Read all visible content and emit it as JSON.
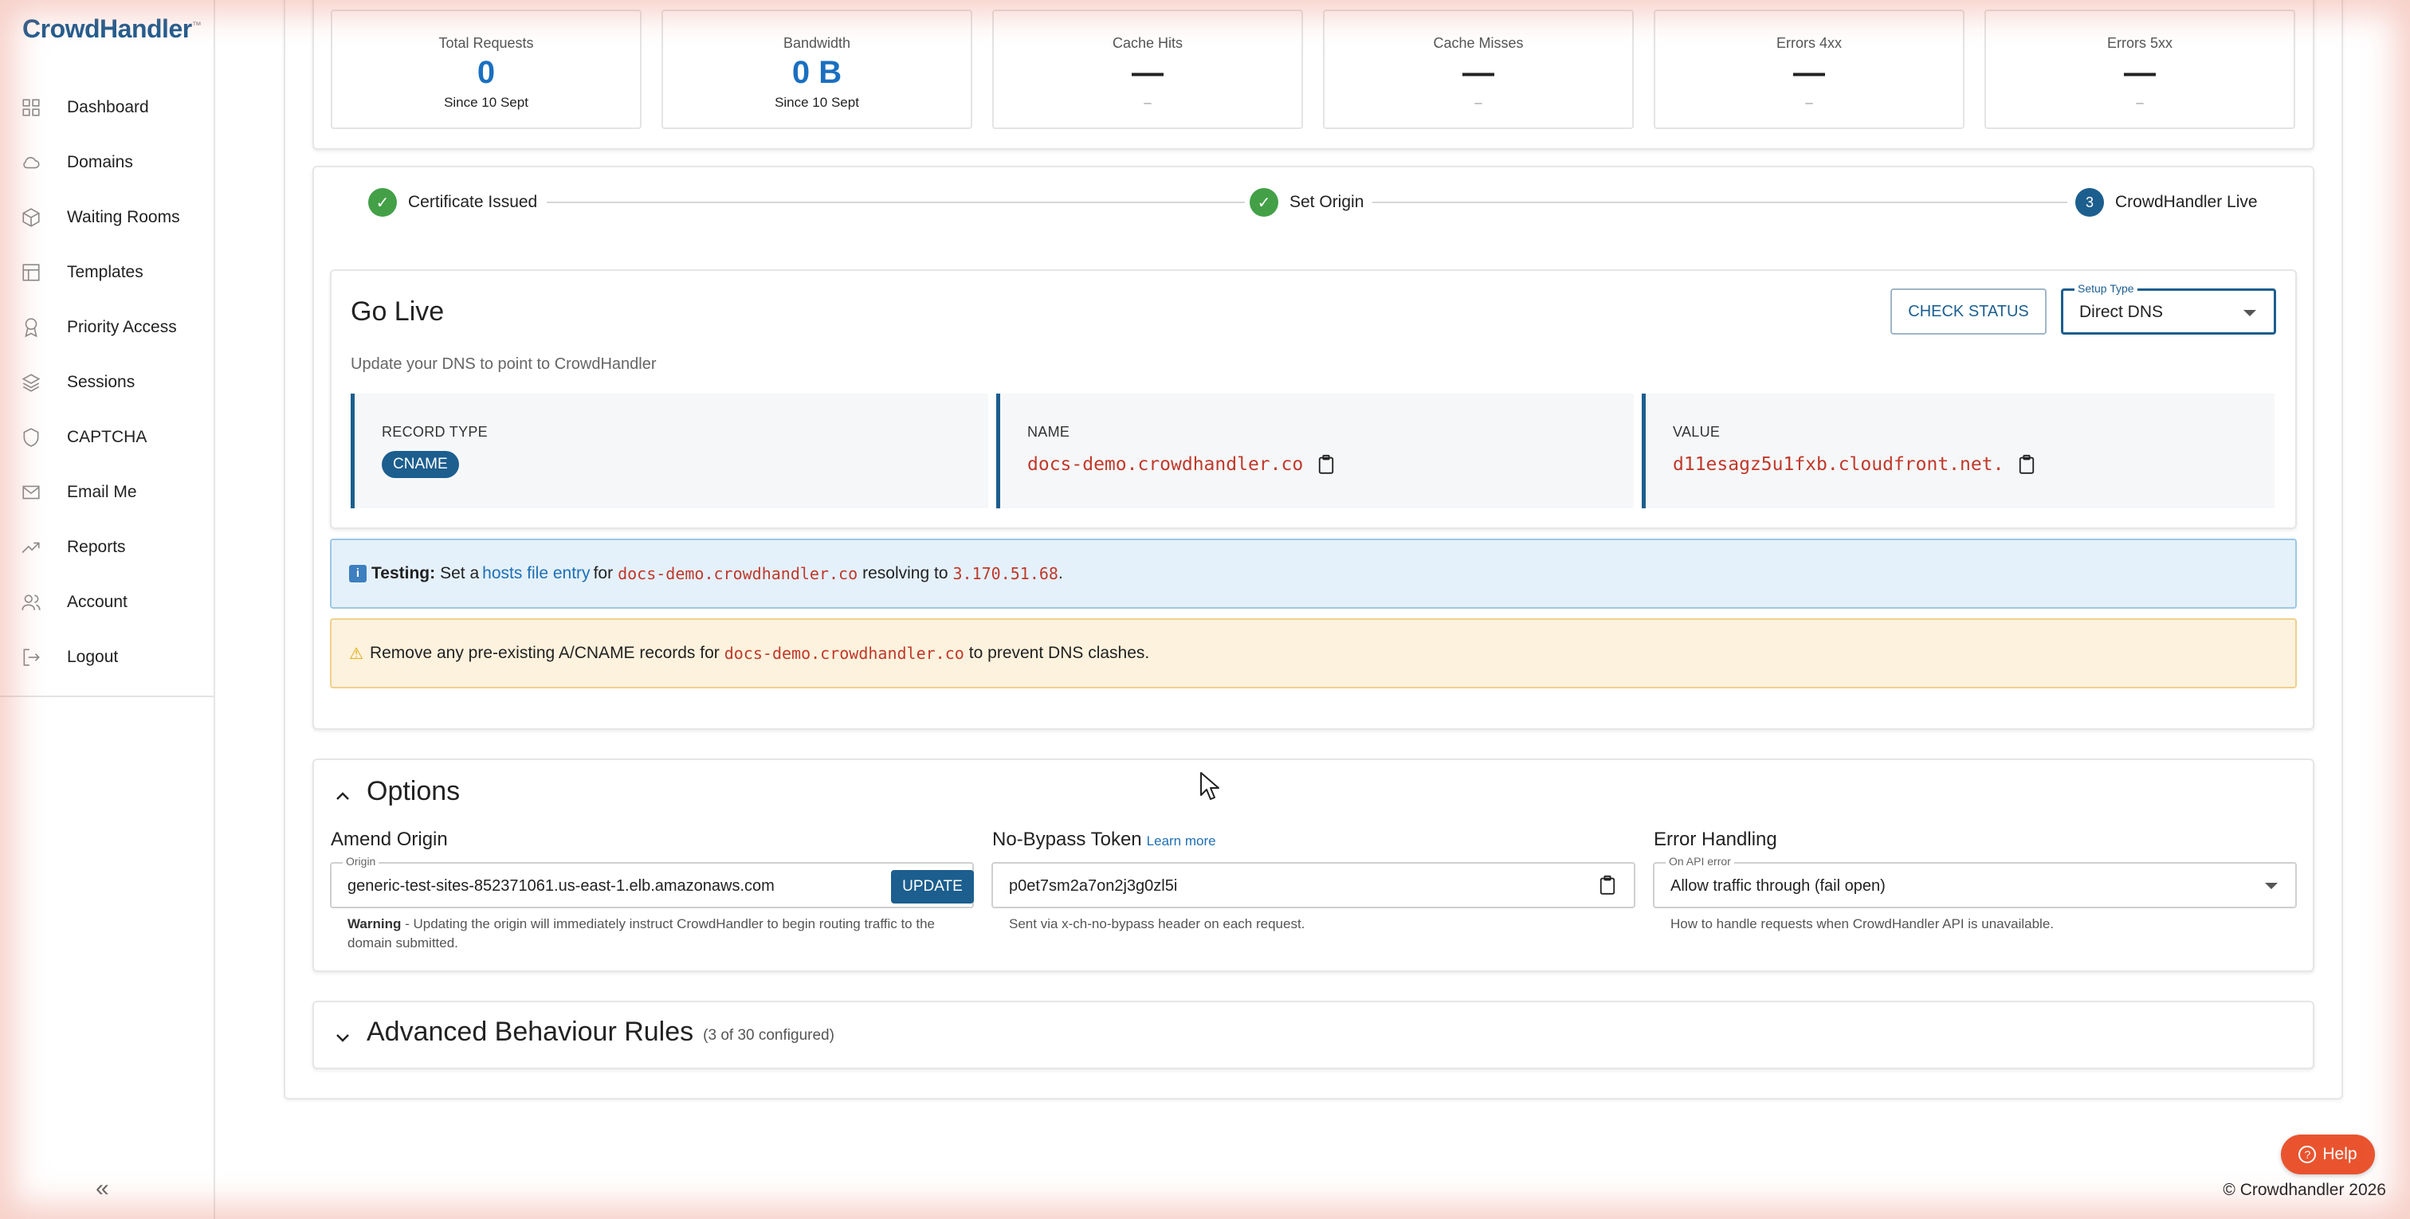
{
  "app": {
    "logo": "CrowdHandler",
    "logo_mark": "™"
  },
  "sidebar": {
    "items": [
      {
        "label": "Dashboard",
        "icon": "grid-icon"
      },
      {
        "label": "Domains",
        "icon": "cloud-icon"
      },
      {
        "label": "Waiting Rooms",
        "icon": "cube-icon"
      },
      {
        "label": "Templates",
        "icon": "layout-icon"
      },
      {
        "label": "Priority Access",
        "icon": "award-icon"
      },
      {
        "label": "Sessions",
        "icon": "layers-icon"
      },
      {
        "label": "CAPTCHA",
        "icon": "shield-icon"
      },
      {
        "label": "Email Me",
        "icon": "mail-icon"
      },
      {
        "label": "Reports",
        "icon": "trend-icon"
      },
      {
        "label": "Account",
        "icon": "users-icon"
      },
      {
        "label": "Logout",
        "icon": "logout-icon"
      }
    ],
    "collapse_label": "«"
  },
  "stats": [
    {
      "label": "Total Requests",
      "value": "0",
      "sub": "Since 10 Sept"
    },
    {
      "label": "Bandwidth",
      "value": "0 B",
      "sub": "Since 10 Sept"
    },
    {
      "label": "Cache Hits",
      "value": "—",
      "sub": "–"
    },
    {
      "label": "Cache Misses",
      "value": "—",
      "sub": "–"
    },
    {
      "label": "Errors 4xx",
      "value": "—",
      "sub": "–"
    },
    {
      "label": "Errors 5xx",
      "value": "—",
      "sub": "–"
    }
  ],
  "stepper": {
    "steps": [
      {
        "label": "Certificate Issued",
        "state": "done",
        "mark": "✓"
      },
      {
        "label": "Set Origin",
        "state": "done",
        "mark": "✓"
      },
      {
        "label": "CrowdHandler Live",
        "state": "current",
        "mark": "3"
      }
    ]
  },
  "golive": {
    "title": "Go Live",
    "subtitle": "Update your DNS to point to CrowdHandler",
    "check_status": "CHECK STATUS",
    "setup_type_legend": "Setup Type",
    "setup_type_value": "Direct DNS",
    "record_type_label": "RECORD TYPE",
    "record_type_value": "CNAME",
    "name_label": "NAME",
    "name_value": "docs-demo.crowdhandler.co",
    "value_label": "VALUE",
    "value_value": "d11esagz5u1fxb.cloudfront.net."
  },
  "alerts": {
    "info": {
      "badge": "i",
      "bold": "Testing:",
      "t1": "Set a",
      "link": "hosts file entry",
      "t2": "for",
      "domain": "docs-demo.crowdhandler.co",
      "t3": "resolving to",
      "ip": "3.170.51.68",
      "t4": "."
    },
    "warn": {
      "icon": "⚠",
      "t1": "Remove any pre-existing A/CNAME records for",
      "domain": "docs-demo.crowdhandler.co",
      "t2": "to prevent DNS clashes."
    }
  },
  "options": {
    "title": "Options",
    "amend_origin": {
      "title": "Amend Origin",
      "legend": "Origin",
      "value": "generic-test-sites-852371061.us-east-1.elb.amazonaws.com",
      "button": "UPDATE",
      "warn_bold": "Warning",
      "warn_text": " - Updating the origin will immediately instruct CrowdHandler to begin routing traffic to the domain submitted."
    },
    "no_bypass": {
      "title": "No-Bypass Token",
      "link": "Learn more",
      "value": "p0et7sm2a7on2j3g0zl5i",
      "helper": "Sent via x-ch-no-bypass header on each request."
    },
    "error_handling": {
      "title": "Error Handling",
      "legend": "On API error",
      "value": "Allow traffic through (fail open)",
      "helper": "How to handle requests when CrowdHandler API is unavailable."
    }
  },
  "advanced": {
    "title": "Advanced Behaviour Rules",
    "count": "(3 of 30 configured)"
  },
  "help": {
    "label": "Help",
    "icon": "?"
  },
  "footer": {
    "copyright": "© Crowdhandler 2026"
  }
}
